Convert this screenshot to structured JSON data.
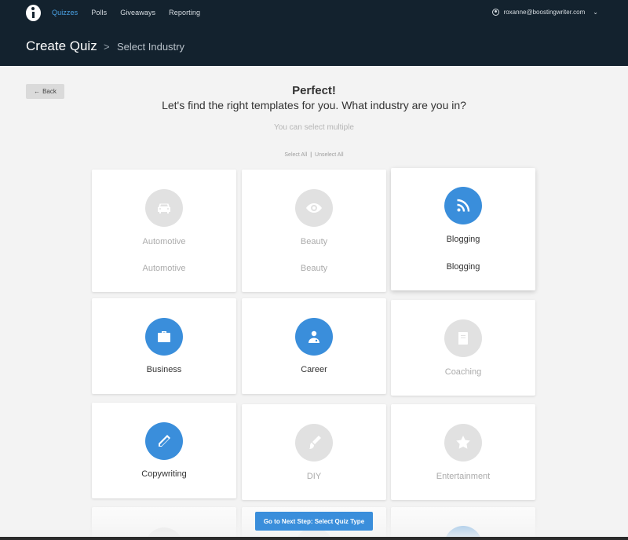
{
  "nav": {
    "links": [
      "Quizzes",
      "Polls",
      "Giveaways",
      "Reporting"
    ],
    "active": "Quizzes",
    "user_email": "roxanne@boostingwriter.com"
  },
  "header": {
    "title": "Create Quiz",
    "separator": ">",
    "subtitle": "Select Industry"
  },
  "back_label": "Back",
  "main": {
    "heading": "Perfect!",
    "question": "Let's find the right templates for you. What industry are you in?",
    "hint": "You can select multiple",
    "select_all": "Select All",
    "unselect_all": "Unselect All"
  },
  "industries": [
    {
      "name": "Automotive",
      "sub": "Automotive",
      "selected": false,
      "icon": "car-icon"
    },
    {
      "name": "Beauty",
      "sub": "Beauty",
      "selected": false,
      "icon": "eye-icon"
    },
    {
      "name": "Blogging",
      "sub": "Blogging",
      "selected": true,
      "icon": "rss-icon"
    },
    {
      "name": "Business",
      "selected": true,
      "icon": "briefcase-icon"
    },
    {
      "name": "Career",
      "selected": true,
      "icon": "doctor-icon"
    },
    {
      "name": "Coaching",
      "selected": false,
      "icon": "book-icon"
    },
    {
      "name": "Copywriting",
      "selected": true,
      "icon": "pencil-icon"
    },
    {
      "name": "DIY",
      "selected": false,
      "icon": "brush-icon"
    },
    {
      "name": "Entertainment",
      "selected": false,
      "icon": "star-icon"
    }
  ],
  "colors": {
    "nav_bg": "#13222e",
    "accent": "#3a8edb",
    "active_link": "#4aa3e6"
  },
  "next_button": "Go to Next Step: Select Quiz Type"
}
